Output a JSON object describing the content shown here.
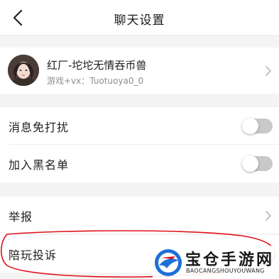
{
  "header": {
    "title": "聊天设置",
    "back_icon": "back-arrow-icon"
  },
  "profile": {
    "name": "红厂-坨坨无情吞币兽",
    "subtitle": "游戏+vx：Tuotuoya0_0",
    "chevron_icon": "chevron-right-icon"
  },
  "settings": {
    "mute_label": "消息免打扰",
    "mute_on": false,
    "blacklist_label": "加入黑名单",
    "blacklist_on": false
  },
  "actions": {
    "report_label": "举报",
    "complaint_label": "陪玩投诉"
  },
  "watermark": {
    "title": "宝仓手游网",
    "subtitle": "BAOCANGSHOUYOUWANG"
  },
  "colors": {
    "page_bg": "#f4f4f4",
    "toggle_off": "#c9c9c9",
    "annotation": "#e0101a",
    "logo_blue": "#1e6fd6"
  }
}
